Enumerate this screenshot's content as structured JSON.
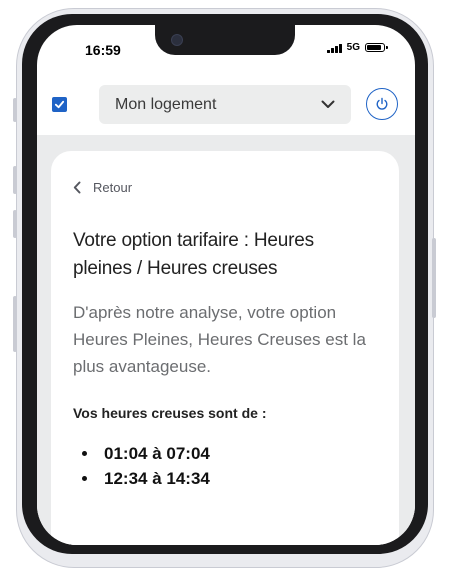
{
  "status_bar": {
    "time": "16:59",
    "network": "5G"
  },
  "header": {
    "dropdown_label": "Mon logement"
  },
  "content": {
    "back_label": "Retour",
    "title": "Votre option tarifaire : Heures pleines / Heures creuses",
    "description": "D'après notre analyse, votre option Heures Pleines, Heures Creuses est la plus avantageuse.",
    "subheading": "Vos heures creuses sont de :",
    "off_peak_hours": [
      "01:04 à 07:04",
      "12:34 à 14:34"
    ]
  },
  "colors": {
    "accent": "#1f63c6",
    "background": "#eaebec",
    "card": "#ffffff"
  },
  "icons": {
    "checkbox": "checkbox-checked-icon",
    "dropdown": "chevron-down-icon",
    "power": "power-icon",
    "back": "chevron-left-icon"
  }
}
